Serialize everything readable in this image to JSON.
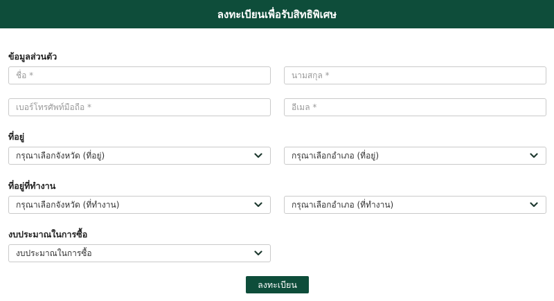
{
  "header": {
    "title": "ลงทะเบียนเพื่อรับสิทธิพิเศษ"
  },
  "personal": {
    "heading": "ข้อมูลส่วนตัว",
    "first_name_placeholder": "ชื่อ *",
    "last_name_placeholder": "นามสกุล *",
    "phone_placeholder": "เบอร์โทรศัพท์มือถือ *",
    "email_placeholder": "อีเมล *"
  },
  "address": {
    "heading": "ที่อยู่",
    "province_value": "กรุณาเลือกจังหวัด (ที่อยู่)",
    "district_value": "กรุณาเลือกอำเภอ (ที่อยู่)"
  },
  "work_address": {
    "heading": "ที่อยู่ที่ทำงาน",
    "province_value": "กรุณาเลือกจังหวัด (ที่ทำงาน)",
    "district_value": "กรุณาเลือกอำเภอ (ที่ทำงาน)"
  },
  "budget": {
    "heading": "งบประมาณในการซื้อ",
    "value": "งบประมาณในการซื้อ"
  },
  "submit_label": "ลงทะเบียน",
  "colors": {
    "brand": "#0e4d3a",
    "border": "#c9c9c9"
  },
  "icons": {
    "select_arrow": "chevron-down-icon"
  }
}
